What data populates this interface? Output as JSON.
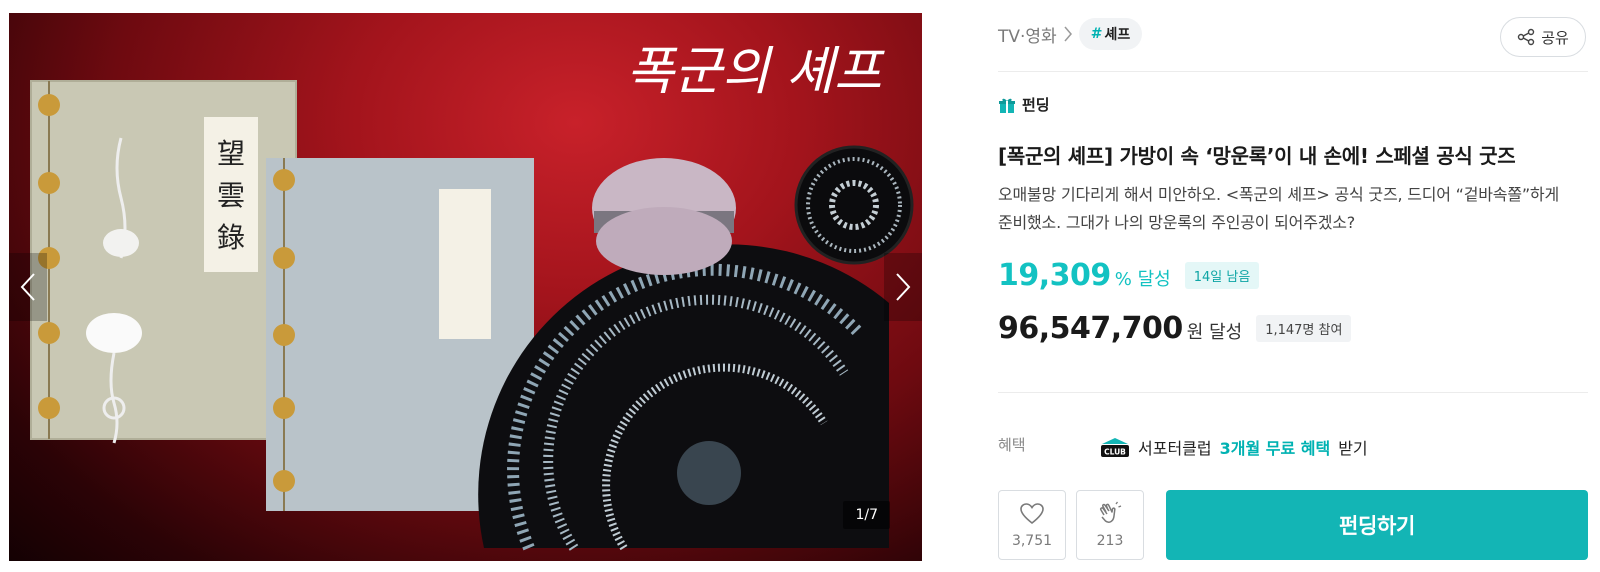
{
  "gallery": {
    "title_logo_text": "폭군의 셰프",
    "scroll_characters": "望雲錄",
    "counter": "1/7",
    "prev_icon": "chevron-left-icon",
    "next_icon": "chevron-right-icon"
  },
  "breadcrumb": {
    "category": "TV·영화",
    "tag_hash": "#",
    "tag_label": "셰프"
  },
  "share": {
    "label": "공유",
    "icon": "share-icon"
  },
  "project": {
    "type_badge": "펀딩",
    "title": "[폭군의 셰프] 가방이 속 ‘망운록’이 내 손에! 스페셜 공식 굿즈",
    "summary": "오매불망 기다리게 해서 미안하오. <폭군의 셰프> 공식 굿즈, 드디어 “겉바속쫄”하게 준비했소. 그대가 나의 망운록의 주인공이 되어주겠소?",
    "achievement_rate": "19,309",
    "achievement_unit": "% 달성",
    "days_left": "14일 남음",
    "amount": "96,547,700",
    "amount_unit": "원 달성",
    "participants": "1,147명 참여"
  },
  "benefit": {
    "label": "혜택",
    "icon": "club-icon",
    "icon_text": "CLUB",
    "prefix": "서포터클럽",
    "accent": "3개월 무료 혜택",
    "suffix": "받기"
  },
  "actions": {
    "like_count": "3,751",
    "cheer_count": "213",
    "fund_label": "펀딩하기"
  },
  "colors": {
    "accent": "#13c2c2",
    "cta": "#13b5b5",
    "gallery_red": "#a3141c"
  }
}
